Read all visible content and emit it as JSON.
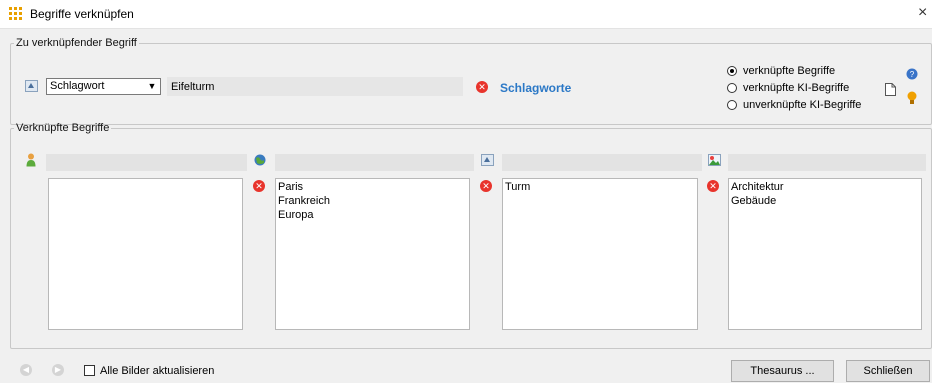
{
  "window": {
    "title": "Begriffe verknüpfen",
    "close_glyph": "×"
  },
  "term_group": {
    "legend": "Zu verknüpfender Begriff",
    "type_icon": "keyword-icon",
    "type_combo": {
      "selected": "Schlagwort",
      "arrow": "▼"
    },
    "term_input": {
      "value": "Eifelturm"
    },
    "remove_glyph": "✕",
    "link_label": "Schlagworte",
    "radios": [
      {
        "label": "verknüpfte Begriffe",
        "selected": true
      },
      {
        "label": "verknüpfte KI-Begriffe",
        "selected": false
      },
      {
        "label": "unverknüpfte KI-Begriffe",
        "selected": false
      }
    ],
    "icons": [
      "document-icon",
      "help-icon",
      "lightbulb-icon"
    ]
  },
  "linked_group": {
    "legend": "Verknüpfte Begriffe",
    "columns": [
      {
        "icon": "person-icon",
        "items": []
      },
      {
        "icon": "globe-icon",
        "items": [
          "Paris",
          "Frankreich",
          "Europa"
        ]
      },
      {
        "icon": "keyword-icon",
        "items": [
          "Turm"
        ]
      },
      {
        "icon": "picture-icon",
        "items": [
          "Architektur",
          "Gebäude"
        ]
      }
    ]
  },
  "footer": {
    "prev_glyph": "◀",
    "next_glyph": "▶",
    "checkbox_label": "Alle Bilder aktualisieren",
    "checkbox_checked": false,
    "thesaurus_button": "Thesaurus ...",
    "close_button": "Schließen"
  },
  "colors": {
    "accent_link": "#2b78c6",
    "remove_red": "#e8342c",
    "title_icon": "#e8a000",
    "bulb": "#f0a000",
    "help": "#3a74c8"
  }
}
